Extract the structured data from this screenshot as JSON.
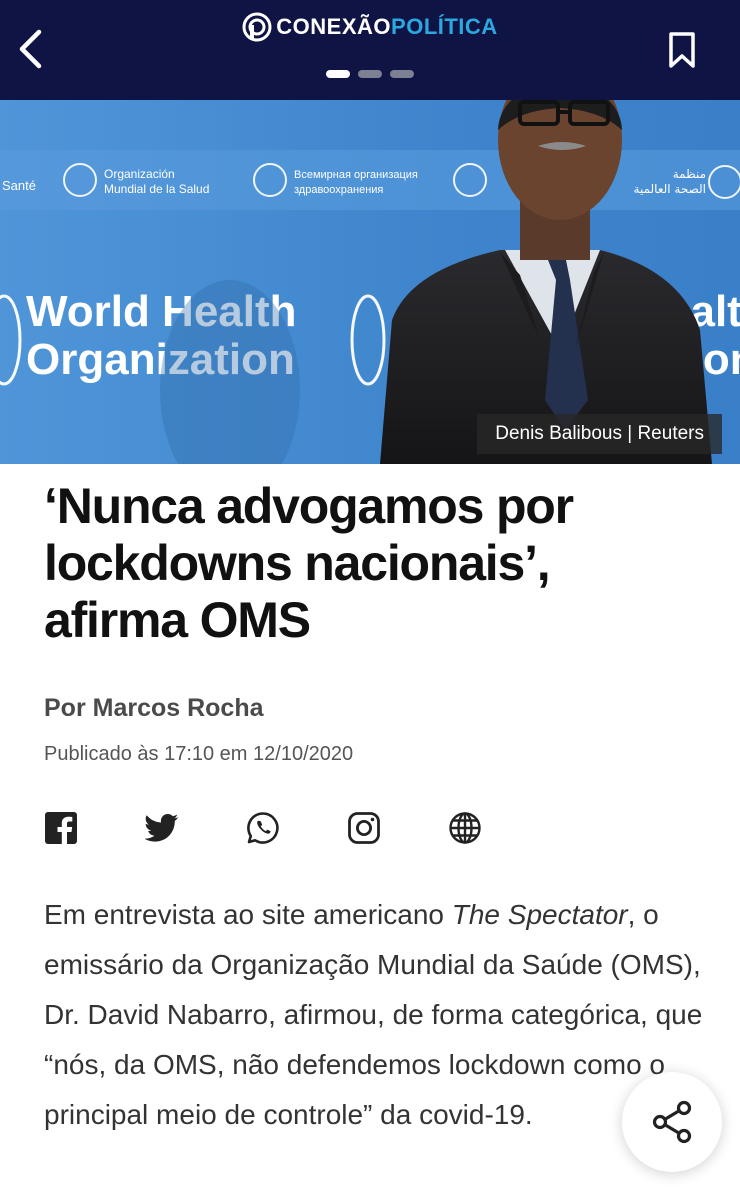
{
  "header": {
    "logo_part1": "CONEXÃO",
    "logo_part2": "POLÍTICA",
    "back_icon": "chevron-left-icon",
    "bookmark_icon": "bookmark-icon",
    "pager": {
      "count": 3,
      "active_index": 0
    }
  },
  "hero": {
    "credit": "Denis Balibous | Reuters",
    "backdrop_text_line1": "World Health",
    "backdrop_text_line2": "Organization",
    "backdrop_right_line1": "ealth",
    "backdrop_right_line2": "tion",
    "banner_es_1": "Organización",
    "banner_es_2": "Mundial de la Salud",
    "banner_ru_1": "Всемирная организация",
    "banner_ru_2": "здравоохранения",
    "banner_fr": "Santé",
    "banner_ar_1": "منظمة",
    "banner_ar_2": "الصحة العالمية"
  },
  "article": {
    "headline": "‘Nunca advogamos por lockdowns nacionais’, afirma OMS",
    "author": "Por Marcos Rocha",
    "published": "Publicado às 17:10 em 12/10/2020",
    "body_part1": "Em entrevista ao site americano ",
    "body_italic": "The Spectator",
    "body_part2": ", o emissário da Organização Mundial da Saúde (OMS), Dr. David Nabarro, afirmou, de forma categórica, que “nós, da OMS, não defendemos lockdown como o principal meio de controle” da covid-19."
  },
  "share": {
    "icons": [
      "facebook-icon",
      "twitter-icon",
      "whatsapp-icon",
      "instagram-icon",
      "globe-icon"
    ],
    "fab_icon": "share-icon"
  },
  "colors": {
    "header_bg": "#0f1445",
    "logo_accent": "#2aa8e0",
    "hero_bg": "#4a8fd4"
  }
}
